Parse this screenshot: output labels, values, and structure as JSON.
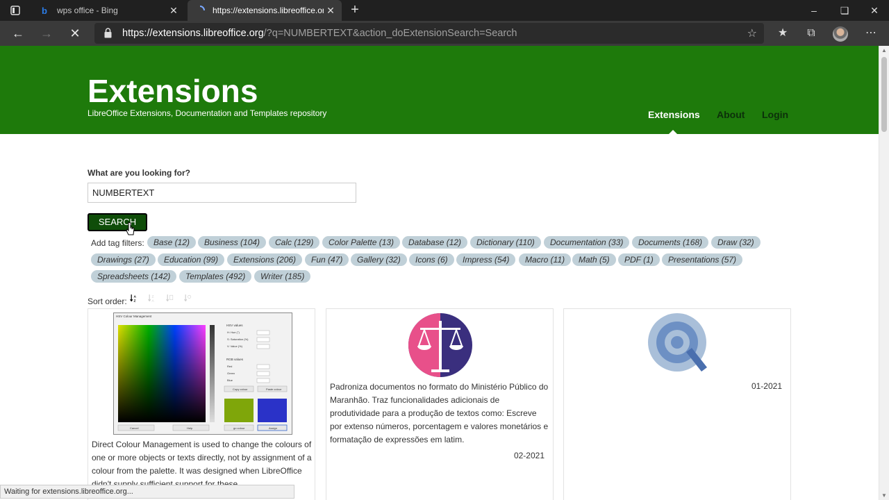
{
  "browser": {
    "tabs": [
      {
        "title": "wps office - Bing",
        "close": "✕"
      },
      {
        "title": "https://extensions.libreoffice.org",
        "close": "✕"
      }
    ],
    "new_tab": "+",
    "url_host": "https://extensions.libreoffice.org",
    "url_path": "/?q=NUMBERTEXT&action_doExtensionSearch=Search"
  },
  "header": {
    "title": "Extensions",
    "subtitle": "LibreOffice Extensions, Documentation and Templates repository",
    "nav": [
      {
        "label": "Extensions",
        "active": true
      },
      {
        "label": "About"
      },
      {
        "label": "Login"
      }
    ]
  },
  "search": {
    "label": "What are you looking for?",
    "value": "NUMBERTEXT",
    "button": "SEARCH"
  },
  "tags": {
    "label": "Add tag filters:",
    "items": [
      "Base (12)",
      "Business (104)",
      "Calc (129)",
      "Color Palette (13)",
      "Database (12)",
      "Dictionary (110)",
      "Documentation (33)",
      "Documents (168)",
      "Draw (32)",
      "Drawings (27)",
      "Education (99)",
      "Extensions (206)",
      "Fun (47)",
      "Gallery (32)",
      "Icons (6)",
      "Impress (54)",
      "Macro (11)",
      "Math (5)",
      "PDF (1)",
      "Presentations (57)",
      "Spreadsheets (142)",
      "Templates (492)",
      "Writer (185)"
    ]
  },
  "sort": {
    "label": "Sort order:"
  },
  "results": [
    {
      "description": "Direct Colour Management is used to change the colours of one or more objects or texts directly, not by assignment of a colour from the palette. It was designed when LibreOffice didn't supply sufficient support for these"
    },
    {
      "description": "Padroniza documentos no formato do Ministério Público do Maranhão. Traz funcionalidades adicionais de produtividade para a produção de textos como: Escreve por extenso números, porcentagem e valores monetários e formatação de expressões em latim.",
      "date": "02-2021"
    },
    {
      "description": "",
      "date": "01-2021"
    }
  ],
  "screenshot": {
    "window_title": "HSV Colour Management",
    "hsv_label": "HSV values",
    "hue": "H: Hue (°)",
    "sat": "S: Saturation (%)",
    "val": "V: Value (%)",
    "rgb_label": "RGB values",
    "red": "Red",
    "green": "Green",
    "blue": "Blue",
    "copy": "Copy colour",
    "paste": "Paste colour",
    "cancel": "Cancel",
    "help": "Help",
    "gocolour": "go colour",
    "assign": "Assign"
  },
  "status": "Waiting for extensions.libreoffice.org...",
  "colors": {
    "header_green": "#1e7a0b",
    "search_button": "#0f4d09",
    "tag_bg": "#c0d0d8"
  }
}
